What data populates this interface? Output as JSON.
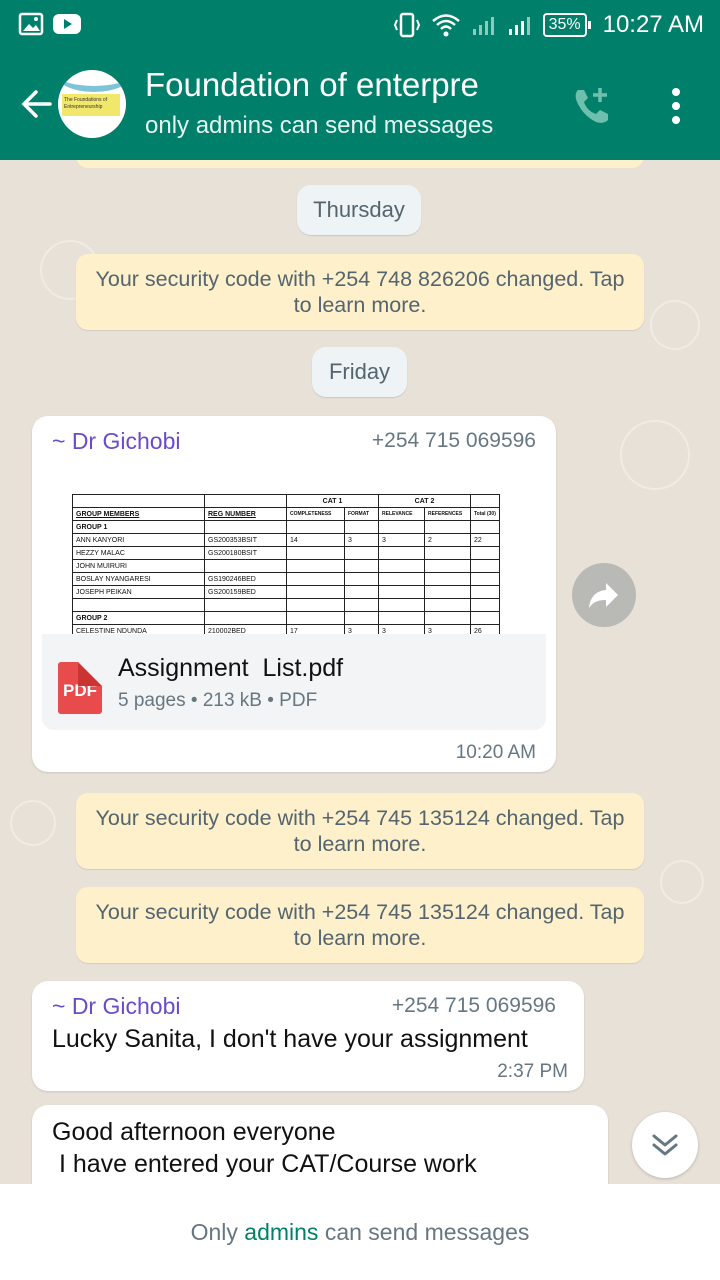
{
  "status_bar": {
    "battery": "35%",
    "time": "10:27 AM",
    "icons": [
      "gallery-icon",
      "youtube-icon",
      "vibrate-icon",
      "wifi-icon",
      "signal-icon",
      "signal-icon"
    ]
  },
  "header": {
    "title": "Foundation of enterpre",
    "subtitle": "only admins can send messages",
    "avatar_text": "The Foundations of Entrepreneurship",
    "icons": [
      "back-arrow-icon",
      "add-call-icon",
      "more-vert-icon"
    ]
  },
  "chat": {
    "date_thursday": "Thursday",
    "sys1": "Your security code with +254 748 826206 changed. Tap to learn more.",
    "date_friday": "Friday",
    "doc_message": {
      "sender": "~ Dr Gichobi",
      "phone": "+254 715 069596",
      "file_name": "Assignment  List.pdf",
      "file_meta": "5 pages • 213 kB • PDF",
      "pdf_label": "PDF",
      "time": "10:20 AM",
      "preview": {
        "group_header": [
          "",
          "",
          "CAT 1",
          "CAT 2",
          ""
        ],
        "columns": [
          "GROUP MEMBERS",
          "REG NUMBER",
          "COMPLETENESS",
          "FORMAT",
          "RELEVANCE",
          "REFERENCES",
          "Total (30)"
        ],
        "rows": [
          [
            "GROUP 1",
            "",
            "",
            "",
            "",
            "",
            ""
          ],
          [
            "ANN KANYORI",
            "GS200353BSIT",
            "14",
            "3",
            "3",
            "2",
            "22"
          ],
          [
            "HEZZY MALAC",
            "GS200180BSIT",
            "",
            "",
            "",
            "",
            ""
          ],
          [
            "JOHN MUIRURI",
            "",
            "",
            "",
            "",
            "",
            ""
          ],
          [
            "BOSLAY NYANGARESI",
            "GS190246BED",
            "",
            "",
            "",
            "",
            ""
          ],
          [
            "JOSEPH PEIKAN",
            "GS200159BED",
            "",
            "",
            "",
            "",
            ""
          ],
          [
            "",
            "",
            "",
            "",
            "",
            "",
            ""
          ],
          [
            "GROUP 2",
            "",
            "",
            "",
            "",
            "",
            ""
          ],
          [
            "CELESTINE NDUNDA",
            "210002BED",
            "17",
            "3",
            "3",
            "3",
            "26"
          ]
        ]
      }
    },
    "sys2": "Your security code with +254 745 135124 changed. Tap to learn more.",
    "sys3": "Your security code with +254 745 135124 changed. Tap to learn more.",
    "text_message": {
      "sender": "~ Dr Gichobi",
      "phone": "+254 715 069596",
      "text": "Lucky Sanita, I don't have your assignment",
      "time": "2:37 PM"
    },
    "last_message": {
      "line1": "Good afternoon everyone",
      "line2": " I have entered your CAT/Course work"
    }
  },
  "footer": {
    "prefix": "Only ",
    "link": "admins",
    "suffix": " can send messages"
  },
  "colors": {
    "primary": "#00806a",
    "sender": "#6a4bc9",
    "system_bg": "#fdf0cb",
    "pdf": "#e74b4b"
  }
}
